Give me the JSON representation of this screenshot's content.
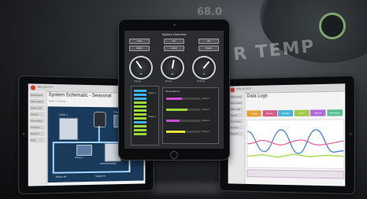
{
  "background": {
    "overlay_text": "R TEMP",
    "overlay_text_top": "68.0"
  },
  "left_tablet": {
    "brand": "VELOCITY",
    "page_title": "System Schematic - Seasonal",
    "page_subtitle": "Stage 1 Cooling",
    "sidebar_items": [
      "Dashboard",
      "Schematics",
      "Data Logs",
      "Alarms",
      "Schedules",
      "Settings",
      "Reports",
      "Help"
    ],
    "schematic_labels": [
      "Chiller 1",
      "Pump 1",
      "Return Air",
      "Supply Air",
      "Cooling Tower",
      "Heat Exchanger"
    ]
  },
  "center_tablet": {
    "dashboard_title": "System Overview",
    "top_buttons": [
      "Auto",
      "On",
      "Off",
      "Alarm",
      "Hand",
      "Reset"
    ],
    "gauges": [
      {
        "label": "Supply",
        "value": "55",
        "angle": -35
      },
      {
        "label": "Return",
        "value": "62",
        "angle": 10
      },
      {
        "label": "Outside",
        "value": "71",
        "angle": 40
      }
    ],
    "ladder_labels": [
      "Stage 1",
      "Stage 2"
    ],
    "bar_panel_title": "Temperatures",
    "bars": [
      {
        "label": "Zone 1",
        "fraction": 0.45,
        "color": "#d04ad8"
      },
      {
        "label": "Zone 2",
        "fraction": 0.62,
        "color": "#9ad83a"
      },
      {
        "label": "Zone 3",
        "fraction": 0.38,
        "color": "#d04ad8"
      },
      {
        "label": "Zone 4",
        "fraction": 0.55,
        "color": "#e8e23a"
      }
    ]
  },
  "right_tablet": {
    "brand": "VELOCITY",
    "page_title": "Data Logs",
    "sidebar_items": [
      "Dashboard",
      "Schematics",
      "Data Logs",
      "Alarms",
      "Schedules",
      "Settings",
      "Reports"
    ],
    "tabs": [
      {
        "label": "Supply",
        "color": "#e2a23a"
      },
      {
        "label": "Return",
        "color": "#d65a8a"
      },
      {
        "label": "Outside",
        "color": "#4ab4d8"
      },
      {
        "label": "Zone",
        "color": "#a0c84a"
      },
      {
        "label": "Mixed",
        "color": "#b06ad8"
      },
      {
        "label": "Discharge",
        "color": "#58c090"
      }
    ],
    "series_colors": [
      "#3a7ad8",
      "#e25a9a",
      "#9ad83a"
    ]
  }
}
